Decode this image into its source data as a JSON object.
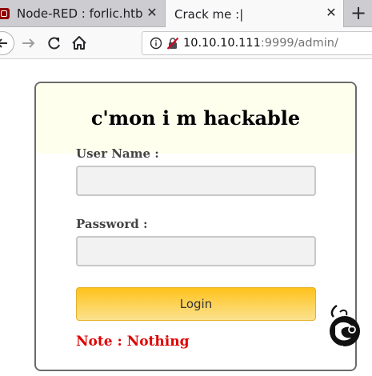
{
  "tabs": [
    {
      "title": "Node-RED : forlic.htb",
      "icon": "node-red-favicon"
    },
    {
      "title": "Crack me :|",
      "icon": "none"
    }
  ],
  "tabs_close": "✕",
  "new_tab": "+",
  "address": {
    "host": "10.10.10.111",
    "rest": ":9999/admin/"
  },
  "page": {
    "title": "c'mon i m hackable",
    "username_label": "User Name :",
    "password_label": "Password :",
    "username_value": "",
    "password_value": "",
    "login_label": "Login",
    "note": "Note : Nothing"
  },
  "colors": {
    "header_bg": "#ffffee",
    "button_top": "#ffc21c",
    "button_bottom": "#fbe28f",
    "note": "#e00000"
  }
}
